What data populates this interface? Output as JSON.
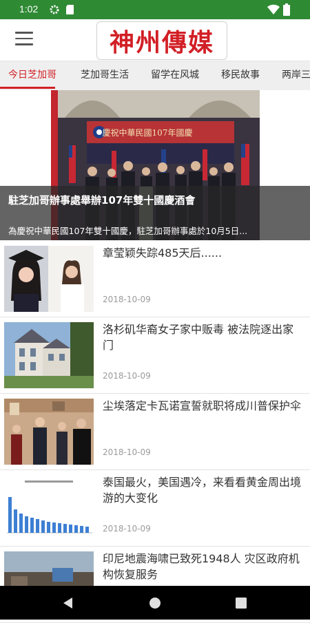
{
  "status": {
    "time": "1:02"
  },
  "app": {
    "logo": "神州傳媒"
  },
  "tabs": [
    {
      "label": "今日芝加哥",
      "active": true
    },
    {
      "label": "芝加哥生活",
      "active": false
    },
    {
      "label": "留学在风城",
      "active": false
    },
    {
      "label": "移民故事",
      "active": false
    },
    {
      "label": "两岸三",
      "active": false
    }
  ],
  "hero": {
    "banner_text": "慶祝中華民國107年國慶",
    "title": "駐芝加哥辦事處舉辦107年雙十國慶酒會",
    "subtitle": "為慶祝中華民國107年雙十國慶，駐芝加哥辦事處於10月5日..."
  },
  "articles": [
    {
      "title": "章莹颖失踪485天后......",
      "date": "2018-10-09"
    },
    {
      "title": "洛杉矶华裔女子家中贩毒 被法院逐出家门",
      "date": "2018-10-09"
    },
    {
      "title": "尘埃落定卡瓦诺宣誓就职将成川普保护伞",
      "date": "2018-10-09"
    },
    {
      "title": "泰国最火，美国遇冷，来看看黄金周出境游的大变化",
      "date": "2018-10-09"
    },
    {
      "title": "印尼地震海啸已致死1948人 灾区政府机构恢复服务",
      "date": ""
    }
  ],
  "colors": {
    "accent": "#d21f26",
    "statusbar": "#2f8a34"
  }
}
